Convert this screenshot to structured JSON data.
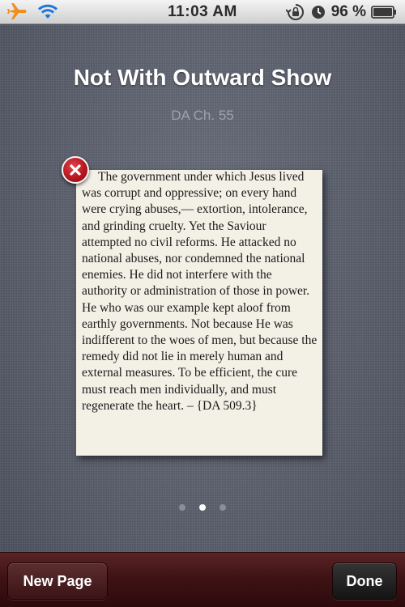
{
  "status_bar": {
    "time": "11:03 AM",
    "battery": "96 %",
    "icons": [
      "airplane-icon",
      "wifi-icon",
      "rotation-lock-icon",
      "alarm-icon",
      "battery-icon"
    ]
  },
  "header": {
    "title": "Not With Outward Show",
    "subtitle": "DA Ch. 55"
  },
  "card": {
    "text": "The government under which Jesus lived was corrupt and oppressive; on every hand were crying abuses,— extortion, intolerance, and grinding cruelty. Yet the Saviour attempted no civil reforms. He attacked no national abuses, nor condemned the national enemies. He did not interfere with the authority or administration of those in power. He who was our example kept aloof from earthly governments. Not because He was indifferent to the woes of men, but because the remedy did not lie in merely human and external measures. To be efficient, the cure must reach men individually, and must regenerate the heart. – {DA 509.3}"
  },
  "pager": {
    "total": 3,
    "current": 2
  },
  "toolbar": {
    "new_page_label": "New Page",
    "done_label": "Done"
  },
  "colors": {
    "close_button": "#c0161f",
    "toolbar": "#3f1315",
    "card_paper": "#f3f0e6"
  }
}
